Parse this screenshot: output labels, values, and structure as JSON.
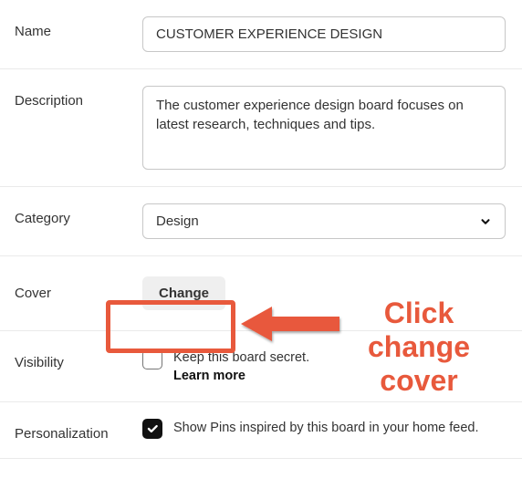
{
  "annotation": {
    "text": "Click change cover",
    "color": "#e8593c"
  },
  "fields": {
    "name": {
      "label": "Name",
      "value": "CUSTOMER EXPERIENCE DESIGN"
    },
    "description": {
      "label": "Description",
      "value": "The customer experience design board focuses on latest research, techniques and tips."
    },
    "category": {
      "label": "Category",
      "selected": "Design"
    },
    "cover": {
      "label": "Cover",
      "button_label": "Change"
    },
    "visibility": {
      "label": "Visibility",
      "text": "Keep this board secret.",
      "learn_more": "Learn more",
      "checked": false
    },
    "personalization": {
      "label": "Personalization",
      "text": "Show Pins inspired by this board in your home feed.",
      "checked": true
    }
  }
}
